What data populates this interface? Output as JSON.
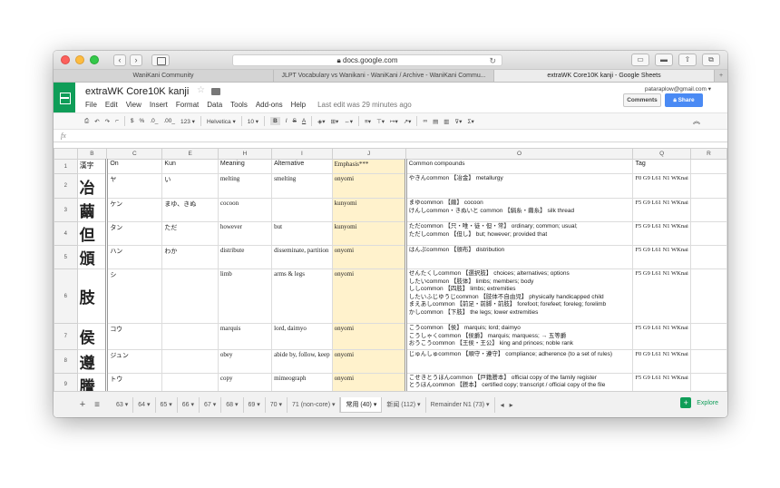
{
  "browser": {
    "url": "docs.google.com",
    "tabs": [
      {
        "label": "WaniKani Community"
      },
      {
        "label": "JLPT Vocabulary vs Wanikani - WaniKani / Archive - WaniKani Commu..."
      },
      {
        "label": "extraWK Core10K kanji - Google Sheets"
      }
    ]
  },
  "app": {
    "title": "extraWK Core10K kanji",
    "account": "pataraplow@gmail.com",
    "comments_label": "Comments",
    "share_label": "Share",
    "menu": [
      "File",
      "Edit",
      "View",
      "Insert",
      "Format",
      "Data",
      "Tools",
      "Add-ons",
      "Help"
    ],
    "last_edit": "Last edit was 29 minutes ago"
  },
  "toolbar": {
    "currency": "$",
    "percent": "%",
    "dec_less": ".0_",
    "dec_more": ".00_",
    "more_formats": "123 ▾",
    "font": "Helvetica ▾",
    "font_size": "10 ▾",
    "bold": "B",
    "italic": "I",
    "strike": "S",
    "text_color": "A"
  },
  "columns": [
    "B",
    "C",
    "E",
    "H",
    "I",
    "J",
    "O",
    "Q",
    "R"
  ],
  "rows": [
    {
      "num": "1",
      "kanji": "漢字",
      "on": "On",
      "kun": "Kun",
      "meaning": "Meaning",
      "alt": "Alternative",
      "emph": "Emphasis***",
      "comp": [
        "Common compounds"
      ],
      "tag": "Tag"
    },
    {
      "num": "2",
      "kanji": "冶",
      "on": "ヤ",
      "kun": "い",
      "meaning": "melting",
      "alt": "smelting",
      "emph": "onyomi",
      "comp": [
        "やきんcommon 【冶金】 metallurgy"
      ],
      "tag": "F0 G9 L61 N1 WKnai"
    },
    {
      "num": "3",
      "kanji": "繭",
      "on": "ケン",
      "kun": "まゆ、きぬ",
      "meaning": "cocoon",
      "alt": "",
      "emph": "kunyomi",
      "comp": [
        "まゆcommon 【繭】 cocoon",
        "けんしcommon・きぬいと common 【絹糸・繭糸】 silk thread"
      ],
      "tag": "F5 G9 L61 N1 WKnai"
    },
    {
      "num": "4",
      "kanji": "但",
      "on": "タン",
      "kun": "ただ",
      "meaning": "however",
      "alt": "but",
      "emph": "kunyomi",
      "comp": [
        "ただcommon 【只・唯・徒・但・常】 ordinary; common; usual;",
        "ただしcommon 【但し】 but; however; provided that"
      ],
      "tag": "F5 G9 L61 N1 WKnai"
    },
    {
      "num": "5",
      "kanji": "頒",
      "on": "ハン",
      "kun": "わか",
      "meaning": "distribute",
      "alt": "disseminate, partition",
      "emph": "onyomi",
      "comp": [
        "はんぷcommon 【頒布】 distribution"
      ],
      "tag": "F5 G9 L61 N1 WKnai"
    },
    {
      "num": "6",
      "kanji": "肢",
      "on": "シ",
      "kun": "",
      "meaning": "limb",
      "alt": "arms & legs",
      "emph": "onyomi",
      "comp": [
        "せんたくしcommon 【選択肢】 choices; alternatives; options",
        "したいcommon 【肢体】 limbs; members; body",
        "ししcommon 【四肢】 limbs; extremities",
        "したいふじゆうじcommon 【肢体不自由児】 physically handicapped child",
        "まえあしcommon 【前足・前脚・前肢】 forefoot; forefeet; foreleg; forelimb",
        "かしcommon 【下肢】 the legs; lower extremities"
      ],
      "tag": "F5 G9 L61 N1 WKnai"
    },
    {
      "num": "7",
      "kanji": "侯",
      "on": "コウ",
      "kun": "",
      "meaning": "marquis",
      "alt": "lord, daimyo",
      "emph": "onyomi",
      "comp": [
        "こうcommon 【侯】 marquis; lord; daimyo",
        "こうしゃくcommon 【侯爵】 marquis; marquess; → 五等爵",
        "おうこうcommon 【王侯・王公】 king and princes; noble rank"
      ],
      "tag": "F5 G9 L61 N1 WKnai"
    },
    {
      "num": "8",
      "kanji": "遵",
      "on": "ジュン",
      "kun": "",
      "meaning": "obey",
      "alt": "abide by, follow, keep",
      "emph": "onyomi",
      "comp": [
        "じゅんしゅcommon 【順守・遵守】 compliance; adherence (to a set of rules)"
      ],
      "tag": "F0 G9 L61 N1 WKnai"
    },
    {
      "num": "9",
      "kanji": "謄",
      "on": "トウ",
      "kun": "",
      "meaning": "copy",
      "alt": "mimeograph",
      "emph": "onyomi",
      "comp": [
        "こせきとうほんcommon 【戸籍謄本】 official copy of the family register",
        "とうほんcommon 【謄本】 certified copy; transcript / official copy of the file"
      ],
      "tag": "F5 G9 L61 N1 WKnai"
    }
  ],
  "sheet_tabs": [
    "63 ▾",
    "64 ▾",
    "65 ▾",
    "66 ▾",
    "67 ▾",
    "68 ▾",
    "69 ▾",
    "70 ▾",
    "71 (non-core) ▾",
    "常用 (40) ▾",
    "新闻 (112) ▾",
    "Remainder N1 (73) ▾"
  ],
  "explore_label": "Explore"
}
